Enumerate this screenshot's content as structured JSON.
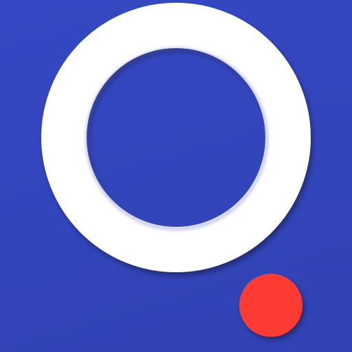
{
  "app_icon": {
    "icon_name": "ring-with-dot-logo-icon",
    "colors": {
      "background_top": "#3548c4",
      "background_bottom": "#3143b5",
      "ring": "#ffffff",
      "ring_shadow": "#1f2f8a",
      "dot": "#fd3b30",
      "dot_shadow": "#a52a2a"
    }
  }
}
